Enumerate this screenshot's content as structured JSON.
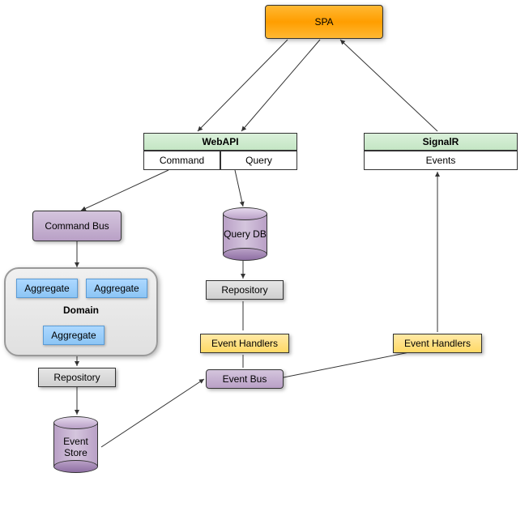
{
  "diagram": {
    "spa": "SPA",
    "webapi": "WebAPI",
    "signalr": "SignalR",
    "command": "Command",
    "query": "Query",
    "events": "Events",
    "commandBus": "Command Bus",
    "queryDb": "Query DB",
    "repository": "Repository",
    "repository2": "Repository",
    "eventHandlers": "Event Handlers",
    "eventHandlers2": "Event Handlers",
    "eventBus": "Event Bus",
    "eventStore": "Event\nStore",
    "domain": "Domain",
    "aggregate1": "Aggregate",
    "aggregate2": "Aggregate",
    "aggregate3": "Aggregate"
  },
  "chart_data": {
    "type": "diagram",
    "title": "CQRS / Event Sourcing Architecture",
    "nodes": [
      {
        "id": "spa",
        "label": "SPA",
        "type": "client"
      },
      {
        "id": "webapi",
        "label": "WebAPI",
        "type": "api",
        "children": [
          "command",
          "query"
        ]
      },
      {
        "id": "signalr",
        "label": "SignalR",
        "type": "api",
        "children": [
          "events"
        ]
      },
      {
        "id": "command",
        "label": "Command",
        "type": "endpoint"
      },
      {
        "id": "query",
        "label": "Query",
        "type": "endpoint"
      },
      {
        "id": "events",
        "label": "Events",
        "type": "endpoint"
      },
      {
        "id": "commandBus",
        "label": "Command Bus",
        "type": "bus"
      },
      {
        "id": "queryDb",
        "label": "Query DB",
        "type": "database"
      },
      {
        "id": "domain",
        "label": "Domain",
        "type": "boundary",
        "children": [
          "aggregate",
          "aggregate",
          "aggregate"
        ]
      },
      {
        "id": "repository1",
        "label": "Repository",
        "type": "component"
      },
      {
        "id": "eventHandlers1",
        "label": "Event Handlers",
        "type": "component"
      },
      {
        "id": "eventHandlers2",
        "label": "Event Handlers",
        "type": "component"
      },
      {
        "id": "eventBus",
        "label": "Event Bus",
        "type": "bus"
      },
      {
        "id": "repository2",
        "label": "Repository",
        "type": "component"
      },
      {
        "id": "eventStore",
        "label": "Event Store",
        "type": "database"
      }
    ],
    "edges": [
      {
        "from": "spa",
        "to": "webapi"
      },
      {
        "from": "signalr",
        "to": "spa"
      },
      {
        "from": "command",
        "to": "commandBus"
      },
      {
        "from": "query",
        "to": "queryDb"
      },
      {
        "from": "commandBus",
        "to": "domain"
      },
      {
        "from": "domain",
        "to": "repository2"
      },
      {
        "from": "repository2",
        "to": "eventStore"
      },
      {
        "from": "queryDb",
        "to": "repository1"
      },
      {
        "from": "repository1",
        "to": "eventHandlers1"
      },
      {
        "from": "eventHandlers1",
        "to": "eventBus"
      },
      {
        "from": "eventBus",
        "to": "eventHandlers2"
      },
      {
        "from": "eventHandlers2",
        "to": "events"
      },
      {
        "from": "eventStore",
        "to": "eventBus"
      }
    ]
  }
}
